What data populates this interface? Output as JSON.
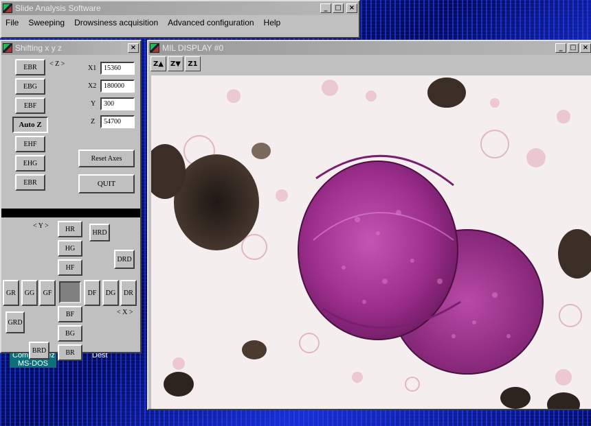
{
  "main_window": {
    "title": "Slide Analysis Software",
    "menu": [
      "File",
      "Sweeping",
      "Drowsiness acquisition",
      "Advanced configuration",
      "Help"
    ]
  },
  "desktop": {
    "item_label": "Commencez MS-DOS",
    "item_label_2": "Dest"
  },
  "shift_window": {
    "title": "Shifting x y z",
    "z_axis_label": "< Z >",
    "z_buttons": [
      "EBR",
      "EBG",
      "EBF",
      "Auto Z",
      "EHF",
      "EHG",
      "EBR"
    ],
    "fields": [
      {
        "label": "X1",
        "value": "15360"
      },
      {
        "label": "X2",
        "value": "180000"
      },
      {
        "label": "Y",
        "value": "300"
      },
      {
        "label": "Z",
        "value": "54700"
      }
    ],
    "reset_label": "Reset Axes",
    "quit_label": "QUIT",
    "y_axis_label": "< Y >",
    "x_axis_label": "< X >",
    "xy_buttons": {
      "hr": "HR",
      "hg": "HG",
      "hf": "HF",
      "hrd": "HRD",
      "drd_right": "DRD",
      "gr": "GR",
      "gg": "GG",
      "gf": "GF",
      "df": "DF",
      "dg": "DG",
      "dr": "DR",
      "grd": "GRD",
      "bf": "BF",
      "bg": "BG",
      "br": "BR",
      "brd": "BRD"
    }
  },
  "mil_window": {
    "title": "MIL DISPLAY #0",
    "tools": [
      "Z▲",
      "Z▼",
      "Z1"
    ]
  },
  "colors": {
    "cell_magenta": "#a0308f",
    "cell_dark": "#6d1a62",
    "debris": "#2a2018",
    "desktop_blue": "#07137a"
  }
}
